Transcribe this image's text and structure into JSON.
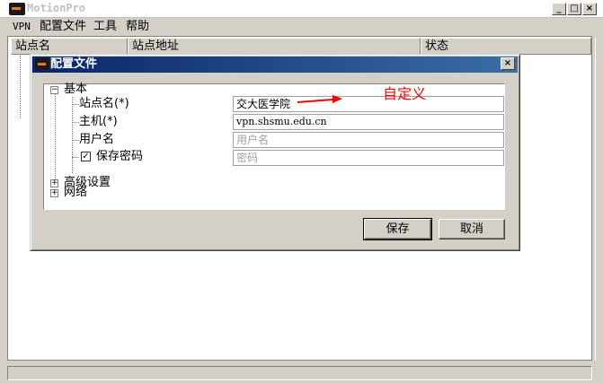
{
  "window": {
    "title": "MotionPro",
    "min": "_",
    "max": "□",
    "close": "×"
  },
  "menu": [
    "VPN",
    "配置文件",
    "工具",
    "帮助"
  ],
  "list": {
    "columns": [
      "站点名",
      "站点地址",
      "状态"
    ]
  },
  "dialog": {
    "title": "配置文件",
    "close": "×",
    "tree": {
      "basic": {
        "label": "基本",
        "toggle": "−"
      },
      "site_name_label": "站点名(*)",
      "site_name_value": "交大医学院",
      "host_label": "主机(*)",
      "host_value": "vpn.shsmu.edu.cn",
      "username_label": "用户名",
      "username_placeholder": "用户名",
      "save_password_label": "保存密码",
      "save_password_checked": "✓",
      "password_placeholder": "密码",
      "advanced": {
        "label": "高级设置",
        "toggle": "+"
      },
      "network": {
        "label": "网络",
        "toggle": "+"
      }
    },
    "buttons": {
      "save": "保存",
      "cancel": "取消"
    }
  },
  "annotation": {
    "text": "自定义",
    "color": "#ff0000"
  }
}
